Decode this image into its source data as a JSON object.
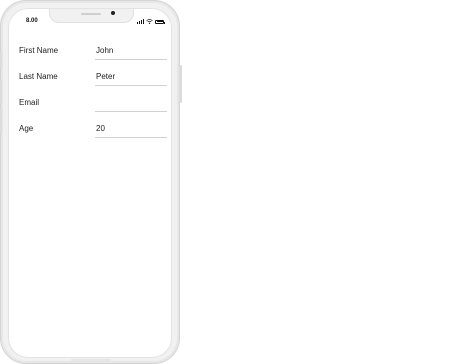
{
  "status_bar": {
    "time": "8.00",
    "icons": [
      "signal-icon",
      "wifi-icon",
      "battery-icon"
    ]
  },
  "form": {
    "fields": [
      {
        "label": "First Name",
        "value": "John",
        "placeholder": ""
      },
      {
        "label": "Last Name",
        "value": "Peter",
        "placeholder": ""
      },
      {
        "label": "Email",
        "value": "",
        "placeholder": ""
      },
      {
        "label": "Age",
        "value": "20",
        "placeholder": ""
      }
    ]
  },
  "colors": {
    "frame": "#f1f1f1",
    "frame_border": "#d4d4d4",
    "screen_background": "#ffffff",
    "text": "#222222",
    "field_underline": "#d2d2d2"
  }
}
